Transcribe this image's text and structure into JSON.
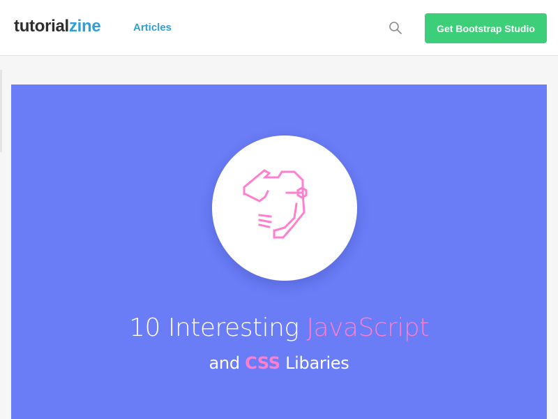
{
  "header": {
    "logo_part1": "tutorial",
    "logo_part2": "zine",
    "nav_articles": "Articles",
    "search_icon": "search-icon",
    "cta_label": "Get Bootstrap Studio"
  },
  "hero": {
    "illustration_icon": "code-robot-icon",
    "title_prefix": "10 Interesting ",
    "title_highlight": "JavaScript",
    "subtitle_prefix": "and ",
    "subtitle_highlight": "CSS",
    "subtitle_suffix": " Libaries"
  },
  "colors": {
    "brand_blue": "#2f9fd6",
    "cta_green": "#3cce78",
    "hero_background": "#6a7cf6",
    "accent_pink": "#ff7fcf"
  }
}
